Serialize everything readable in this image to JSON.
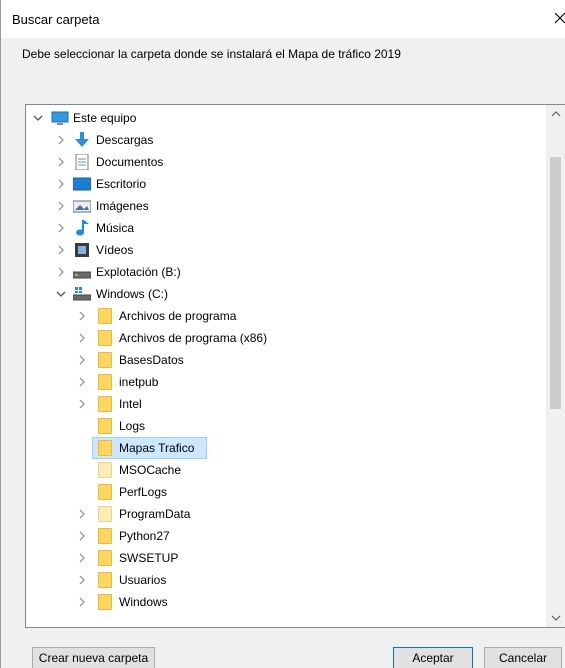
{
  "window": {
    "title": "Buscar carpeta",
    "close_glyph": "✕",
    "description": "Debe seleccionar la carpeta donde se instalará el Mapa de tráfico 2019"
  },
  "tree": {
    "selected": "Mapas Trafico",
    "items": [
      {
        "label": "Este equipo",
        "icon": "computer-icon",
        "level": 0,
        "expanded": true
      },
      {
        "label": "Descargas",
        "icon": "download-arrow-icon",
        "level": 1
      },
      {
        "label": "Documentos",
        "icon": "document-icon",
        "level": 1
      },
      {
        "label": "Escritorio",
        "icon": "desktop-icon",
        "level": 1
      },
      {
        "label": "Imágenes",
        "icon": "pictures-icon",
        "level": 1
      },
      {
        "label": "Música",
        "icon": "music-note-icon",
        "level": 1
      },
      {
        "label": "Vídeos",
        "icon": "film-icon",
        "level": 1
      },
      {
        "label": "Explotación (B:)",
        "icon": "drive-icon",
        "level": 1
      },
      {
        "label": "Windows  (C:)",
        "icon": "windows-drive-icon",
        "level": 1,
        "expanded": true
      },
      {
        "label": "Archivos de programa",
        "icon": "folder-icon",
        "level": 2
      },
      {
        "label": "Archivos de programa (x86)",
        "icon": "folder-icon",
        "level": 2
      },
      {
        "label": "BasesDatos",
        "icon": "folder-icon",
        "level": 2
      },
      {
        "label": "inetpub",
        "icon": "folder-icon",
        "level": 2
      },
      {
        "label": "Intel",
        "icon": "folder-icon",
        "level": 2
      },
      {
        "label": "Logs",
        "icon": "folder-icon",
        "level": 2
      },
      {
        "label": "Mapas Trafico",
        "icon": "folder-icon",
        "level": 2
      },
      {
        "label": "MSOCache",
        "icon": "folder-icon",
        "level": 2
      },
      {
        "label": "PerfLogs",
        "icon": "folder-icon",
        "level": 2
      },
      {
        "label": "ProgramData",
        "icon": "folder-icon",
        "level": 2
      },
      {
        "label": "Python27",
        "icon": "folder-icon",
        "level": 2
      },
      {
        "label": "SWSETUP",
        "icon": "folder-icon",
        "level": 2
      },
      {
        "label": "Usuarios",
        "icon": "folder-icon",
        "level": 2
      },
      {
        "label": "Windows",
        "icon": "folder-icon",
        "level": 2
      }
    ]
  },
  "buttons": {
    "new_folder": "Crear nueva carpeta",
    "ok": "Aceptar",
    "cancel": "Cancelar"
  },
  "colors": {
    "selection": "#cce8ff",
    "folder": "#ffd75e",
    "accent": "#0078d7"
  }
}
